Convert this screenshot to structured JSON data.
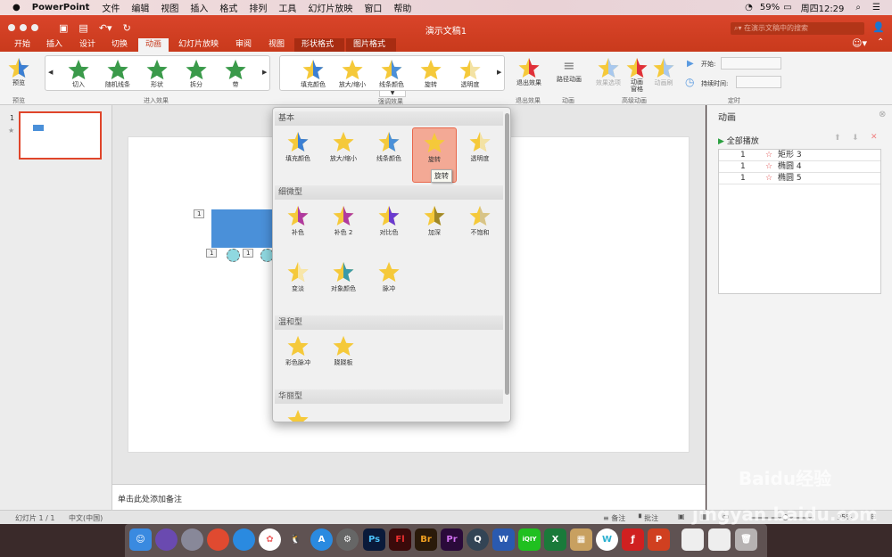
{
  "menubar": {
    "app": "PowerPoint",
    "items": [
      "文件",
      "编辑",
      "视图",
      "插入",
      "格式",
      "排列",
      "工具",
      "幻灯片放映",
      "窗口",
      "帮助"
    ],
    "battery": "59%",
    "clock": "周四12:29"
  },
  "window": {
    "title": "演示文稿1",
    "search_placeholder": "在演示文稿中的搜索"
  },
  "tabs": [
    "开始",
    "插入",
    "设计",
    "切换",
    "动画",
    "幻灯片放映",
    "审阅",
    "视图",
    "形状格式",
    "图片格式"
  ],
  "ribbon": {
    "preview": "预览",
    "preview_group": "预览",
    "entrance": [
      "切入",
      "随机线条",
      "形状",
      "拆分",
      "带"
    ],
    "entrance_group": "进入效果",
    "emphasis": [
      "填充颜色",
      "放大/缩小",
      "线条颜色",
      "旋转",
      "透明度"
    ],
    "emphasis_group": "强调效果",
    "exit": "退出效果",
    "exit_group": "退出效果",
    "path": "路径动画",
    "path_group": "动画",
    "effect_options": "效果选项",
    "anim_pane": "动画\n窗格",
    "anim_painter": "动画刷",
    "advanced_group": "高级动画",
    "start_label": "开始:",
    "duration_label": "持续时间:",
    "timing_group": "定时"
  },
  "thumbs": {
    "slide_number": "1",
    "star": "★"
  },
  "slide": {
    "tags": [
      "1",
      "1",
      "1"
    ]
  },
  "notes": {
    "placeholder": "单击此处添加备注"
  },
  "pane": {
    "title": "动画",
    "play_all": "全部播放",
    "items": [
      {
        "order": "1",
        "name": "矩形 3"
      },
      {
        "order": "1",
        "name": "椭圆 4"
      },
      {
        "order": "1",
        "name": "椭圆 5"
      }
    ]
  },
  "status": {
    "slide": "幻灯片 1 / 1",
    "lang": "中文(中国)",
    "notes": "备注",
    "comments": "批注",
    "zoom": "95%",
    "zoom_fraction": 0.55
  },
  "popup": {
    "sections": [
      {
        "title": "基本",
        "items": [
          {
            "label": "填充颜色",
            "color": "#3b7fd4"
          },
          {
            "label": "放大/缩小",
            "color": "#f5c93a"
          },
          {
            "label": "线条颜色",
            "color": "#4a90d9"
          },
          {
            "label": "旋转",
            "color": "#f5c93a"
          },
          {
            "label": "透明度",
            "color": "#f3e2a4"
          }
        ]
      },
      {
        "title": "细微型",
        "items": [
          {
            "label": "补色",
            "color": "#b03aa0"
          },
          {
            "label": "补色 2",
            "color": "#b03aa0"
          },
          {
            "label": "对比色",
            "color": "#6a3ad0"
          },
          {
            "label": "加深",
            "color": "#a08828"
          },
          {
            "label": "不饱和",
            "color": "#d8c488"
          },
          {
            "label": "变淡",
            "color": "#f8e6a8"
          },
          {
            "label": "对象颜色",
            "color": "#3a9aa8"
          },
          {
            "label": "脉冲",
            "color": "#f5c93a"
          }
        ]
      },
      {
        "title": "温和型",
        "items": [
          {
            "label": "彩色脉冲",
            "color": "#f5c93a"
          },
          {
            "label": "跷跷板",
            "color": "#f5c93a"
          }
        ]
      },
      {
        "title": "华丽型",
        "items": [
          {
            "label": "",
            "color": "#f5c93a"
          }
        ]
      }
    ],
    "tooltip": "旋转"
  },
  "colors": {
    "accent": "#d24726",
    "star_yellow": "#f5c93a",
    "entrance_green": "#3a9a4a",
    "exit_red": "#e0303a"
  },
  "dock": [
    "Ps",
    "Fl",
    "Br",
    "Pr",
    "W",
    "iQIY",
    "X",
    "W",
    "P"
  ],
  "watermark": "Baidu经验 jingyan.baidu.com"
}
